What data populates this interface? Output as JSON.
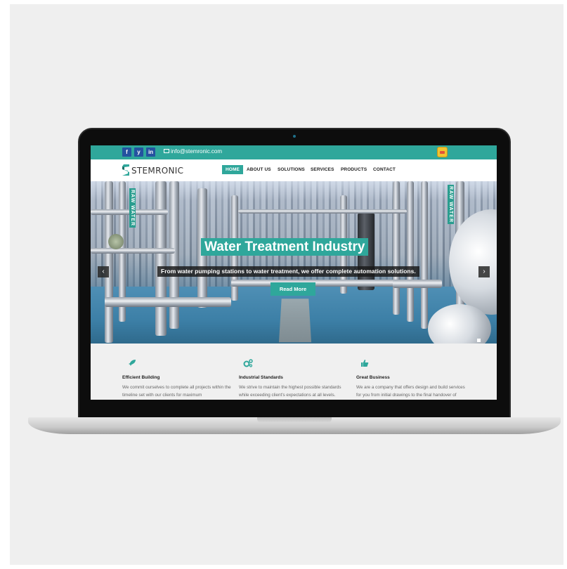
{
  "topbar": {
    "social": [
      {
        "icon": "facebook-icon",
        "glyph": "f"
      },
      {
        "icon": "twitter-icon",
        "glyph": "y"
      },
      {
        "icon": "linkedin-icon",
        "glyph": "in"
      }
    ],
    "email": "info@stemronic.com"
  },
  "brand": {
    "name": "STEMRONIC"
  },
  "nav": {
    "items": [
      "HOME",
      "ABOUT US",
      "SOLUTIONS",
      "SERVICES",
      "PRODUCTS",
      "CONTACT"
    ]
  },
  "hero": {
    "title": "Water Treatment Industry",
    "subtitle": "From water pumping stations to water treatment, we offer complete automation solutions.",
    "button": "Read More",
    "prev": "‹",
    "next": "›",
    "sign_left": "RAW WATER",
    "sign_right": "RAW WATER"
  },
  "features": [
    {
      "icon": "rocket-icon",
      "glyph": "🚀",
      "title": "Efficient Building",
      "text": "We commit ourselves to complete all projects within the timeline set with our clients for maximum"
    },
    {
      "icon": "gears-icon",
      "glyph": "⚙",
      "title": "Industrial Standards",
      "text": "We strive to maintain the highest possible standards while exceeding client's expectations at all levels."
    },
    {
      "icon": "thumbs-up-icon",
      "glyph": "👍",
      "title": "Great Business",
      "text": "We are a company that offers design and build services for you from initial drawings to the final handover of"
    }
  ],
  "colors": {
    "accent": "#2fa79b",
    "social": "#2452a0"
  }
}
